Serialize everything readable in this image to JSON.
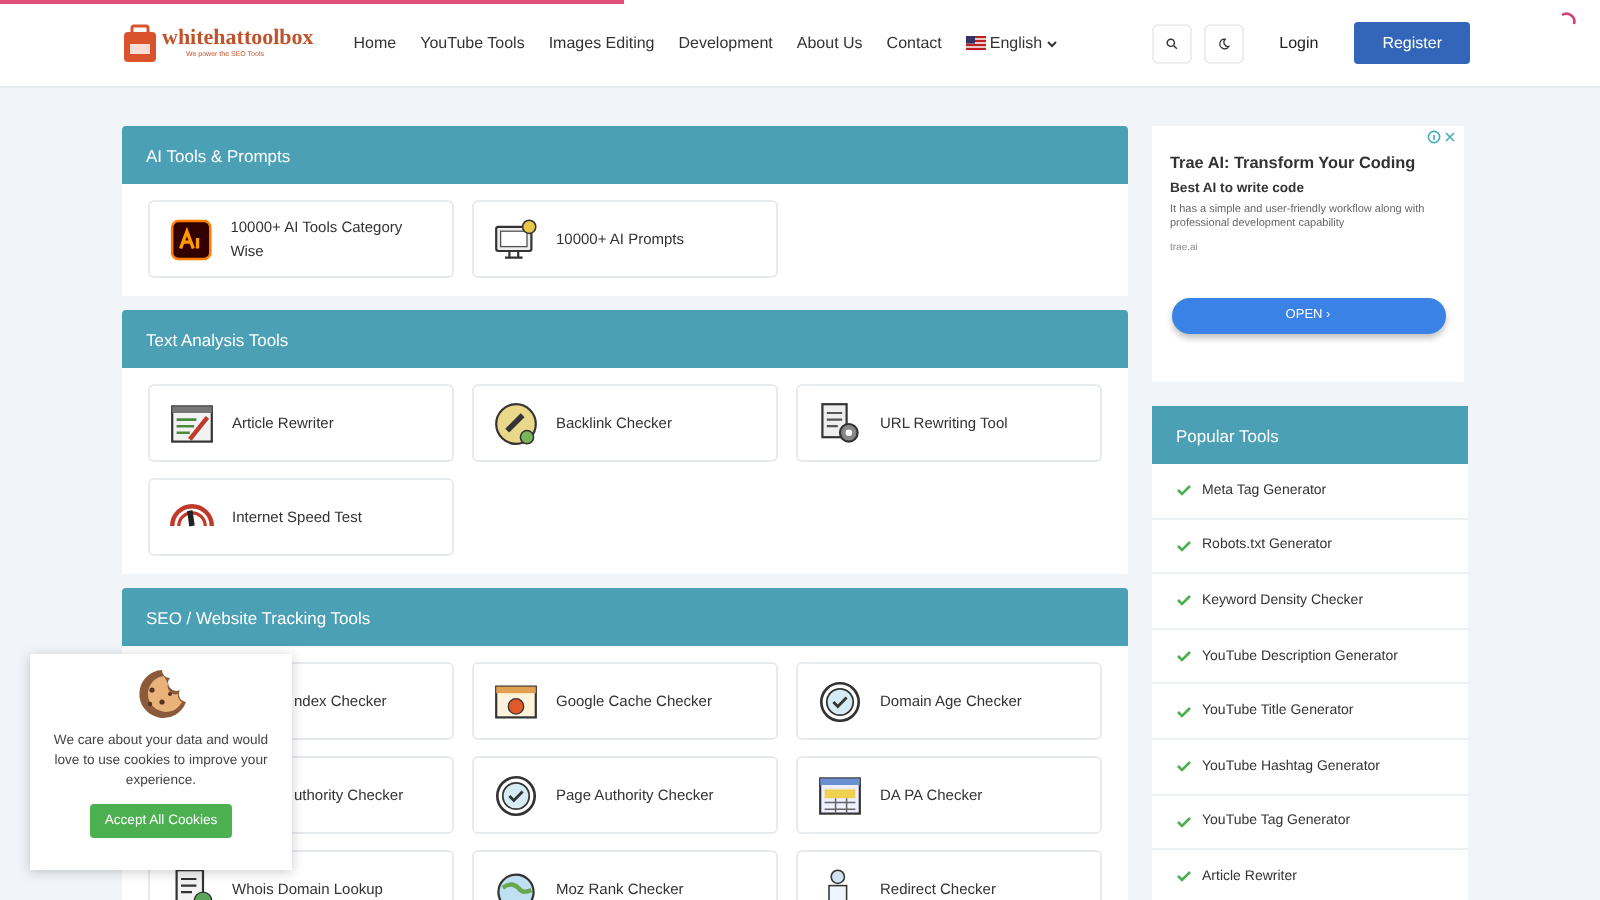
{
  "page_loader": {
    "level": 0.39
  },
  "header": {
    "logo": {
      "name": "whitehattoolbox",
      "tagline": "We power the SEO Tools"
    },
    "nav": [
      {
        "label": "Home"
      },
      {
        "label": "YouTube Tools"
      },
      {
        "label": "Images Editing"
      },
      {
        "label": "Development"
      },
      {
        "label": "About Us"
      },
      {
        "label": "Contact"
      }
    ],
    "language": {
      "label": "English"
    },
    "login": "Login",
    "register": "Register"
  },
  "sections": [
    {
      "title": "AI Tools & Prompts",
      "tools": [
        {
          "label": "10000+ AI Tools Category Wise",
          "kind": "card"
        },
        {
          "label": "10000+ AI Prompts",
          "kind": "card"
        }
      ]
    },
    {
      "title": "Text Analysis Tools",
      "tools": [
        {
          "label": "Article Rewriter",
          "kind": "card"
        },
        {
          "label": "Backlink Checker",
          "kind": "card"
        },
        {
          "label": "URL Rewriting Tool",
          "kind": "card"
        },
        {
          "label": "Internet Speed Test",
          "kind": "card"
        }
      ]
    },
    {
      "title": "SEO / Website Tracking Tools",
      "tools": [
        {
          "label": "ndex Checker",
          "kind": "covered"
        },
        {
          "label": "Google Cache Checker",
          "kind": "card"
        },
        {
          "label": "Domain Age Checker",
          "kind": "card"
        },
        {
          "label": "uthority Checker",
          "kind": "covered"
        },
        {
          "label": "Page Authority Checker",
          "kind": "card"
        },
        {
          "label": "DA PA Checker",
          "kind": "card"
        },
        {
          "label": "Whois Domain Lookup",
          "kind": "card"
        },
        {
          "label": "Moz Rank Checker",
          "kind": "card"
        },
        {
          "label": "Redirect Checker",
          "kind": "card"
        }
      ]
    }
  ],
  "ad": {
    "title": "Trae AI: Transform Your Coding",
    "subtitle": "Best AI to write code",
    "description": "It has a simple and user-friendly workflow along with professional development capability",
    "domain": "trae.ai",
    "button": "OPEN ›"
  },
  "popular_tools": {
    "title": "Popular Tools",
    "items": [
      {
        "label": "Meta Tag Generator"
      },
      {
        "label": "Robots.txt Generator"
      },
      {
        "label": "Keyword Density Checker"
      },
      {
        "label": "YouTube Description Generator"
      },
      {
        "label": "YouTube Title Generator"
      },
      {
        "label": "YouTube Hashtag Generator"
      },
      {
        "label": "YouTube Tag Generator"
      },
      {
        "label": "Article Rewriter"
      }
    ]
  },
  "cookie_notice": {
    "message": "We care about your data and would love to use cookies to improve your experience.",
    "button": "Accept All Cookies"
  }
}
